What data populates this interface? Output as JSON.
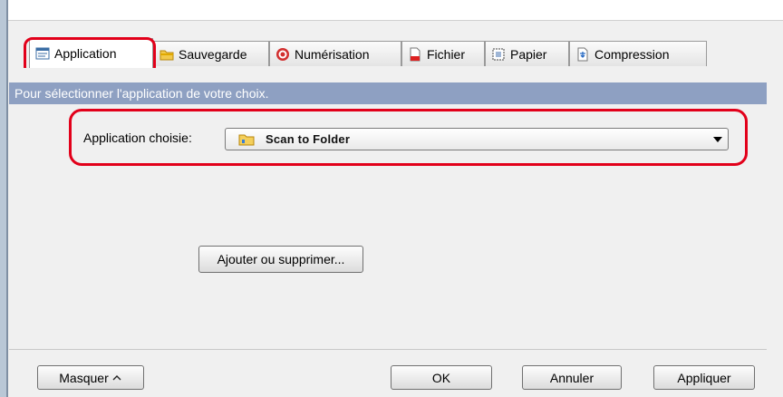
{
  "tabs": [
    {
      "label": "Application",
      "icon": "application-icon",
      "active": true
    },
    {
      "label": "Sauvegarde",
      "icon": "save-folder-icon",
      "active": false
    },
    {
      "label": "Numérisation",
      "icon": "scan-icon",
      "active": false
    },
    {
      "label": "Fichier",
      "icon": "file-icon",
      "active": false
    },
    {
      "label": "Papier",
      "icon": "paper-icon",
      "active": false
    },
    {
      "label": "Compression",
      "icon": "compression-icon",
      "active": false
    }
  ],
  "banner": {
    "text": "Pour sélectionner l'application de votre choix."
  },
  "application": {
    "label": "Application choisie:",
    "selected": "Scan to Folder",
    "selected_icon": "folder-icon"
  },
  "buttons": {
    "add_remove": "Ajouter ou supprimer...",
    "hide": "Masquer",
    "ok": "OK",
    "cancel": "Annuler",
    "apply": "Appliquer"
  },
  "colors": {
    "callout": "#e2001a",
    "banner": "#8ea0c2"
  }
}
